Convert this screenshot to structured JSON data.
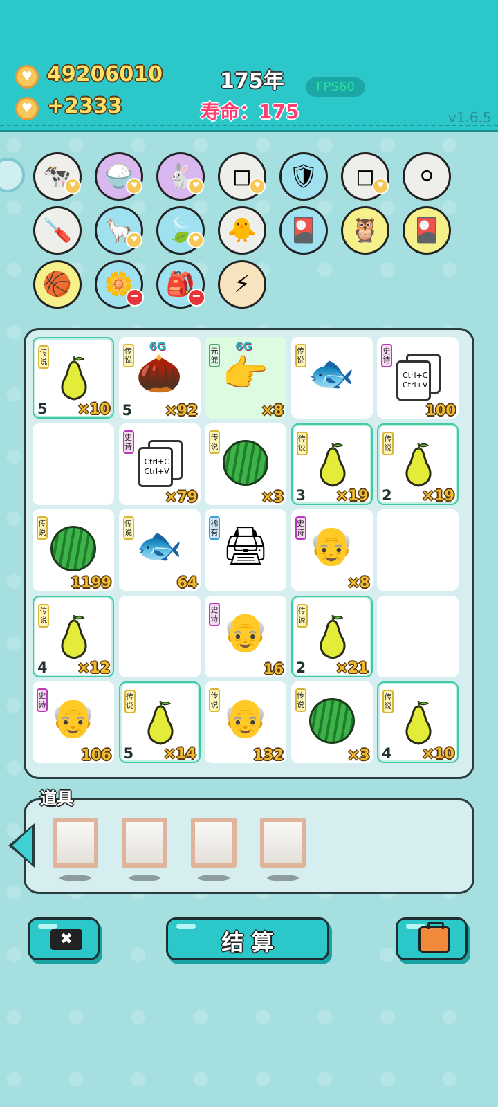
{
  "header": {
    "coins": "49206010",
    "coins_gain": "+2333",
    "year": "175年",
    "lifespan": "寿命：175",
    "fps": "FPS60",
    "version": "v1.6.5"
  },
  "icon_rows": [
    [
      "cow-twins-icon",
      "rice-bowl-icon",
      "rabbit-icon",
      "sugar-cubes-icon",
      "shield-wrench-icon",
      "sugar-cubes-icon",
      "egg-tray-icon"
    ],
    [
      "screwdriver-icon",
      "alpaca-icon",
      "leaf-icon",
      "chick-egg-icon",
      "card-pack-icon",
      "owls-icon",
      "card-pack-icon"
    ],
    [
      "basketballs-icon",
      "flower-pot-icon",
      "sack-icon",
      "lightning-icon"
    ]
  ],
  "grid": [
    [
      {
        "tag": "传说",
        "tag_type": "chuan",
        "item": "pear",
        "level": "5",
        "count": "×10",
        "hl": true
      },
      {
        "tag": "传说",
        "tag_type": "chuan",
        "item": "longan",
        "level": "5",
        "count": "×92",
        "g": "6G"
      },
      {
        "tag": "元兜",
        "tag_type": "yuan",
        "item": "hand",
        "count": "×8",
        "g": "6G",
        "green": true
      },
      {
        "tag": "传说",
        "tag_type": "chuan",
        "item": "koi",
        "count": ""
      },
      {
        "tag": "史诗",
        "tag_type": "shi",
        "item": "copy",
        "count": "100"
      }
    ],
    [
      {
        "item": "empty"
      },
      {
        "tag": "史诗",
        "tag_type": "shi",
        "item": "copy",
        "count": "×79"
      },
      {
        "tag": "传说",
        "tag_type": "chuan",
        "item": "melon",
        "count": "×3"
      },
      {
        "tag": "传说",
        "tag_type": "chuan",
        "item": "pear",
        "level": "3",
        "count": "×19",
        "hl": true
      },
      {
        "tag": "传说",
        "tag_type": "chuan",
        "item": "pear",
        "level": "2",
        "count": "×19",
        "hl": true
      }
    ],
    [
      {
        "tag": "传说",
        "tag_type": "chuan",
        "item": "melon",
        "count": "1199"
      },
      {
        "tag": "传说",
        "tag_type": "chuan",
        "item": "koi",
        "count": "64"
      },
      {
        "tag": "稀有",
        "tag_type": "xi",
        "item": "printer",
        "count": ""
      },
      {
        "tag": "史诗",
        "tag_type": "shi",
        "item": "oldman",
        "count": "×8"
      },
      {
        "item": "empty"
      }
    ],
    [
      {
        "tag": "传说",
        "tag_type": "chuan",
        "item": "pear",
        "level": "4",
        "count": "×12",
        "hl": true
      },
      {
        "item": "empty"
      },
      {
        "tag": "史诗",
        "tag_type": "shi",
        "item": "oldman",
        "count": "16"
      },
      {
        "tag": "传说",
        "tag_type": "chuan",
        "item": "pear",
        "level": "2",
        "count": "×21",
        "hl": true
      },
      {
        "item": "empty"
      }
    ],
    [
      {
        "tag": "史诗",
        "tag_type": "shi",
        "item": "oldman",
        "count": "106"
      },
      {
        "tag": "传说",
        "tag_type": "chuan",
        "item": "pear",
        "level": "5",
        "count": "×14",
        "hl": true
      },
      {
        "tag": "传说",
        "tag_type": "chuan",
        "item": "grandpa",
        "count": "132"
      },
      {
        "tag": "传说",
        "tag_type": "chuan",
        "item": "melon",
        "count": "×3"
      },
      {
        "tag": "传说",
        "tag_type": "chuan",
        "item": "pear",
        "level": "4",
        "count": "×10",
        "hl": true
      }
    ]
  ],
  "copy_text": [
    "Ctrl+C",
    "Ctrl+V"
  ],
  "props": {
    "title": "道具"
  },
  "buttons": {
    "settle": "结 算",
    "cancel_glyph": "✖"
  }
}
